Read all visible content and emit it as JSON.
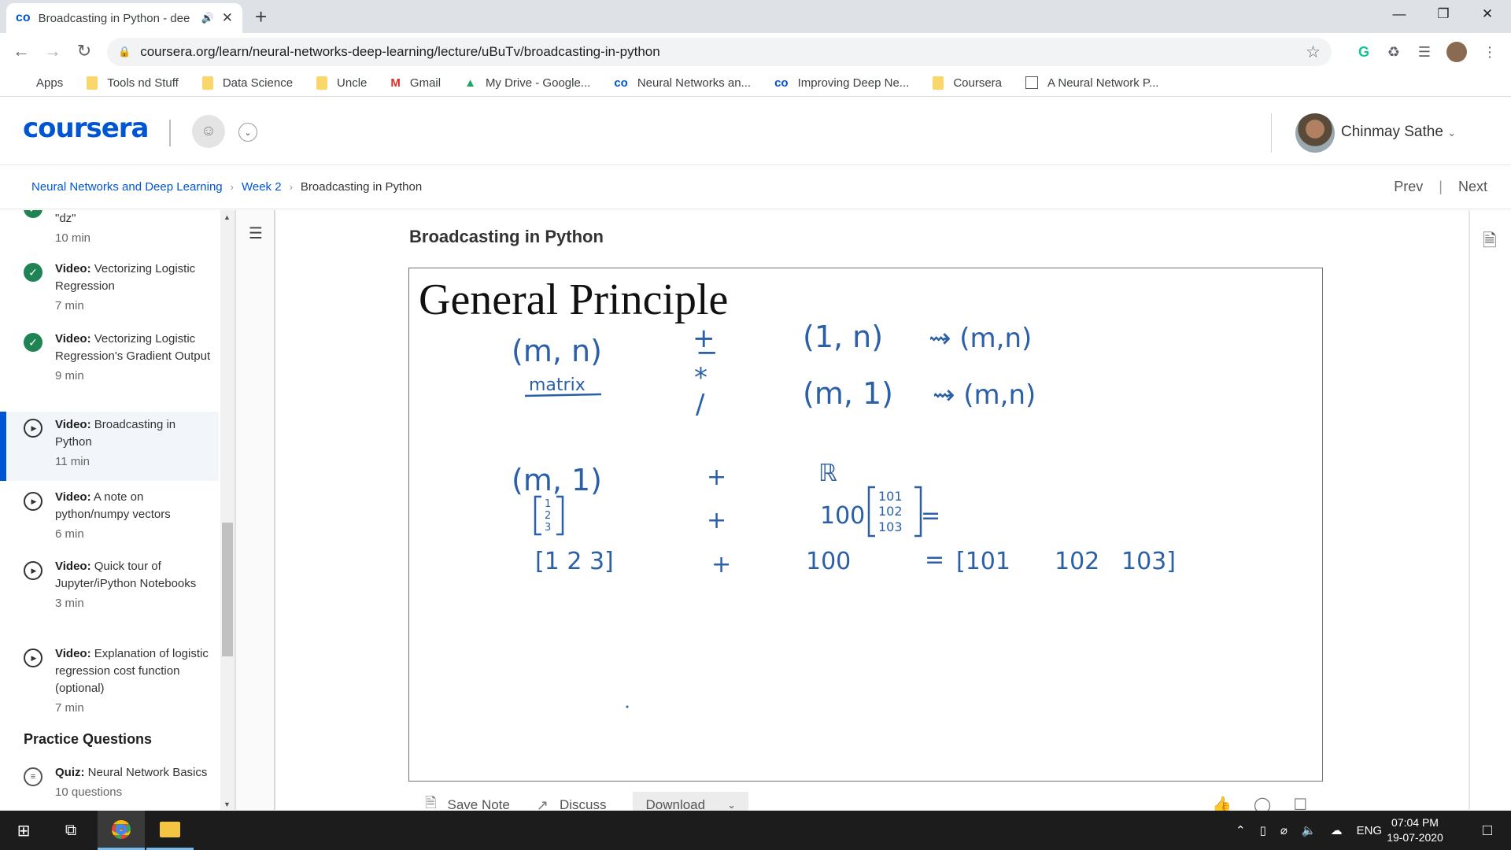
{
  "browser": {
    "tab_title": "Broadcasting in Python - dee",
    "tab_favicon": "co",
    "address": "coursera.org/learn/neural-networks-deep-learning/lecture/uBuTv/broadcasting-in-python",
    "bookmarks": [
      {
        "label": "Apps",
        "icon": "apps-grid-icon"
      },
      {
        "label": "Tools nd Stuff",
        "icon": "folder-icon"
      },
      {
        "label": "Data Science",
        "icon": "folder-icon"
      },
      {
        "label": "Uncle",
        "icon": "folder-icon"
      },
      {
        "label": "Gmail",
        "icon": "gmail-icon"
      },
      {
        "label": "My Drive - Google...",
        "icon": "drive-icon"
      },
      {
        "label": "Neural Networks an...",
        "icon": "coursera-icon"
      },
      {
        "label": "Improving Deep Ne...",
        "icon": "coursera-icon"
      },
      {
        "label": "Coursera",
        "icon": "folder-icon"
      },
      {
        "label": "A Neural Network P...",
        "icon": "page-icon"
      }
    ]
  },
  "header": {
    "logo": "coursera",
    "user_name": "Chinmay Sathe"
  },
  "breadcrumb": {
    "course": "Neural Networks and Deep Learning",
    "week": "Week 2",
    "current": "Broadcasting in Python",
    "prev": "Prev",
    "next": "Next"
  },
  "sidebar": {
    "items": [
      {
        "title": "\"dz\"",
        "duration": "10 min",
        "status": "done"
      },
      {
        "kind": "Video:",
        "title": "Vectorizing Logistic Regression",
        "duration": "7 min",
        "status": "done"
      },
      {
        "kind": "Video:",
        "title": "Vectorizing Logistic Regression's Gradient Output",
        "duration": "9 min",
        "status": "done"
      },
      {
        "kind": "Video:",
        "title": "Broadcasting in Python",
        "duration": "11 min",
        "status": "active"
      },
      {
        "kind": "Video:",
        "title": "A note on python/numpy vectors",
        "duration": "6 min",
        "status": "play"
      },
      {
        "kind": "Video:",
        "title": "Quick tour of Jupyter/iPython Notebooks",
        "duration": "3 min",
        "status": "play"
      },
      {
        "kind": "Video:",
        "title": "Explanation of logistic regression cost function (optional)",
        "duration": "7 min",
        "status": "play"
      }
    ],
    "section_heading": "Practice Questions",
    "quiz": {
      "kind": "Quiz:",
      "title": "Neural Network Basics",
      "duration": "10 questions"
    }
  },
  "main": {
    "lecture_title": "Broadcasting in Python",
    "slide_title": "General Principle",
    "ink": {
      "mn": "(m, n)",
      "matrix": "matrix",
      "ops": [
        "+",
        "−",
        "*",
        "/"
      ],
      "one_n": "(1, n)",
      "m_one": "(m, 1)",
      "arrow1": "⇝ (m,n)",
      "arrow2": "⇝ (m,n)",
      "m1": "(m, 1)",
      "plus": "+",
      "R": "ℝ",
      "col": [
        "1",
        "2",
        "3"
      ],
      "hundred": "100",
      "eq": "=",
      "res_col": [
        "101",
        "102",
        "103"
      ],
      "row": "[1  2  3]",
      "res_row": [
        "[101",
        "102",
        "103]"
      ]
    },
    "actions": {
      "save_note": "Save Note",
      "discuss": "Discuss",
      "download": "Download"
    }
  },
  "taskbar": {
    "lang": "ENG",
    "time": "07:04 PM",
    "date": "19-07-2020"
  }
}
